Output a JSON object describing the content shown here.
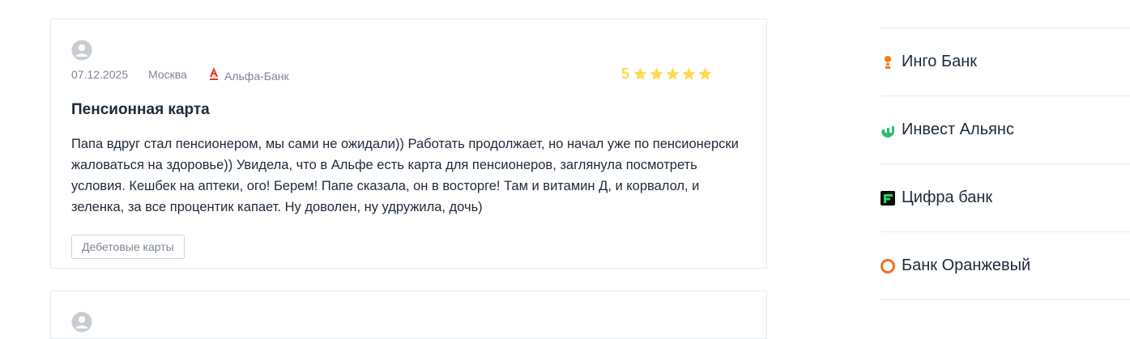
{
  "review": {
    "date": "07.12.2025",
    "city": "Москва",
    "bank": "Альфа-Банк",
    "rating": "5",
    "rating_stars": 5,
    "title": "Пенсионная карта",
    "text": "Папа вдруг стал пенсионером, мы сами не ожидали)) Работать продолжает, но начал уже по пенсионерски жаловаться на здоровье)) Увидела, что в Альфе есть карта для пенсионеров, заглянула посмотреть условия. Кешбек на аптеки, ого! Берем! Папе сказала, он в восторге! Там и витамин Д, и корвалол, и зеленка, за все процентик капает. Ну доволен, ну удружила, дочь)",
    "tag": "Дебетовые карты"
  },
  "sidebar": {
    "items": [
      {
        "label": "Инго Банк",
        "icon": "ingo-bank-logo-icon",
        "color": "#f47b20"
      },
      {
        "label": "Инвест Альянс",
        "icon": "invest-alliance-logo-icon",
        "color": "#2fbf71"
      },
      {
        "label": "Цифра банк",
        "icon": "cifra-bank-logo-icon",
        "color": "#1ed760"
      },
      {
        "label": "Банк Оранжевый",
        "icon": "orange-bank-logo-icon",
        "color": "#f26e21"
      }
    ]
  },
  "colors": {
    "star": "#ffd84d",
    "alfa_red": "#ef3124",
    "text": "#1e2a3a",
    "muted": "#7c8593",
    "border": "#e6e9ee"
  }
}
